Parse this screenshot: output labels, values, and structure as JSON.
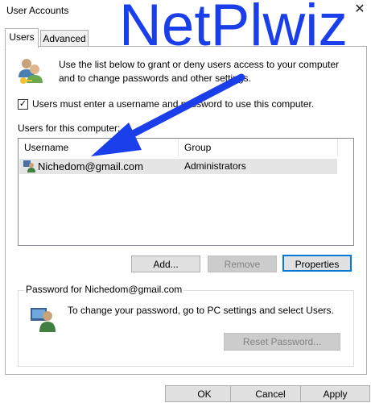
{
  "window": {
    "title": "User Accounts",
    "close_glyph": "✕"
  },
  "tabs": [
    {
      "label": "Users",
      "active": true
    },
    {
      "label": "Advanced",
      "active": false
    }
  ],
  "intro": {
    "icon": "users-icon",
    "text": "Use the list below to grant or deny users access to your computer and to change passwords and other settings."
  },
  "require_login": {
    "checked": true,
    "label": "Users must enter a username and password to use this computer."
  },
  "users_group_label": "Users for this computer:",
  "user_table": {
    "columns": [
      "Username",
      "Group"
    ],
    "rows": [
      {
        "username": "Nichedom@gmail.com",
        "group": "Administrators",
        "icon": "user-icon"
      }
    ]
  },
  "buttons": {
    "add": "Add...",
    "remove": "Remove",
    "properties": "Properties"
  },
  "password_group": {
    "legend": "Password for Nichedom@gmail.com",
    "text": "To change your password, go to PC settings and select Users.",
    "reset_button": "Reset Password..."
  },
  "footer_buttons": {
    "ok": "OK",
    "cancel": "Cancel",
    "apply": "Apply"
  },
  "overlay": {
    "text": "NetPlwiz",
    "color": "#1a3eea"
  }
}
